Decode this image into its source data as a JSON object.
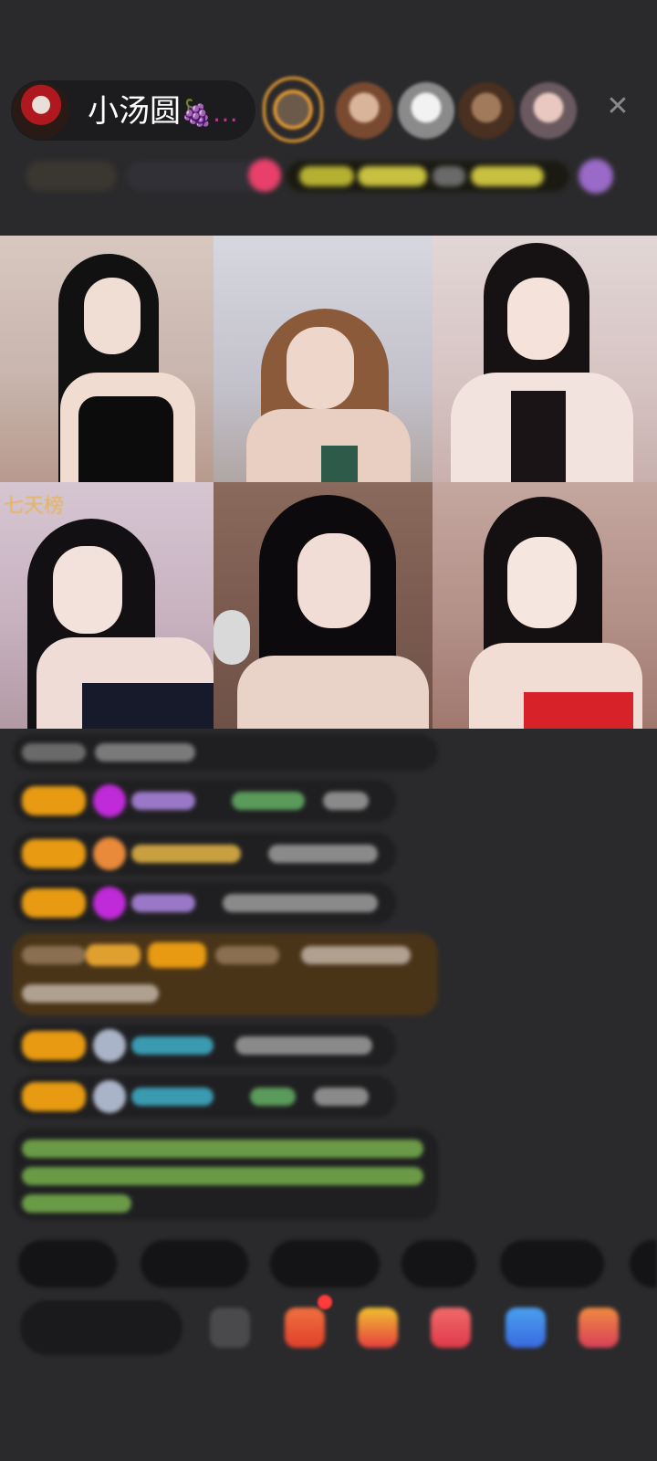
{
  "header": {
    "host_name": "小汤圆",
    "host_name_suffix": "🍇…",
    "viewers": [
      "viewer-1",
      "viewer-2",
      "viewer-3",
      "viewer-4",
      "viewer-5"
    ],
    "close_icon": "close-icon"
  },
  "video_grid": {
    "badge_label": "七天榜",
    "tiles": [
      "streamer-1",
      "streamer-2",
      "streamer-3",
      "streamer-4",
      "streamer-5",
      "streamer-6"
    ]
  },
  "chat": {
    "messages": [
      "message-1",
      "message-2",
      "message-3",
      "message-4",
      "message-5",
      "message-6",
      "message-7",
      "message-8"
    ]
  },
  "colors": {
    "background": "#2a2a2c",
    "badge_yellow": "#e79a12",
    "accent_orange": "#f0a030"
  }
}
